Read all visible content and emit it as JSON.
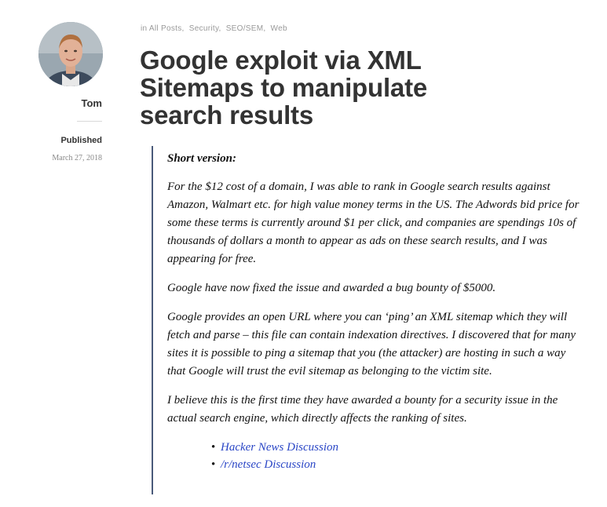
{
  "author": {
    "name": "Tom",
    "published_label": "Published",
    "published_date": "March 27, 2018"
  },
  "post": {
    "categories_prefix": "in",
    "categories": [
      "All Posts",
      "Security",
      "SEO/SEM",
      "Web"
    ],
    "title": "Google exploit via XML Sitemaps to manipulate search results",
    "short_version_heading": "Short version:",
    "paragraphs": [
      "For the $12 cost of a domain, I was able to rank in Google search results against Amazon, Walmart etc. for high value money terms in the US. The Adwords bid price for some these terms is currently around $1 per click, and companies are spendings 10s of thousands of dollars a month to appear as ads on these search results, and I was appearing for free.",
      "Google have now fixed the issue and awarded a bug bounty of $5000.",
      "Google provides an open URL where you can ‘ping’ an XML sitemap which they will fetch and parse – this file can contain indexation directives. I discovered that for many sites it is possible to ping a sitemap that you (the attacker) are hosting in such a way that Google will trust the evil sitemap as belonging to the victim site.",
      "I believe this is the first time they have awarded a bounty for a security issue in the actual search engine, which directly affects the ranking of sites."
    ],
    "links": [
      "Hacker News Discussion",
      "/r/netsec Discussion"
    ]
  },
  "colors": {
    "link": "#2a46c6",
    "quote_border": "#4a5a7a",
    "meta_gray": "#999999"
  }
}
